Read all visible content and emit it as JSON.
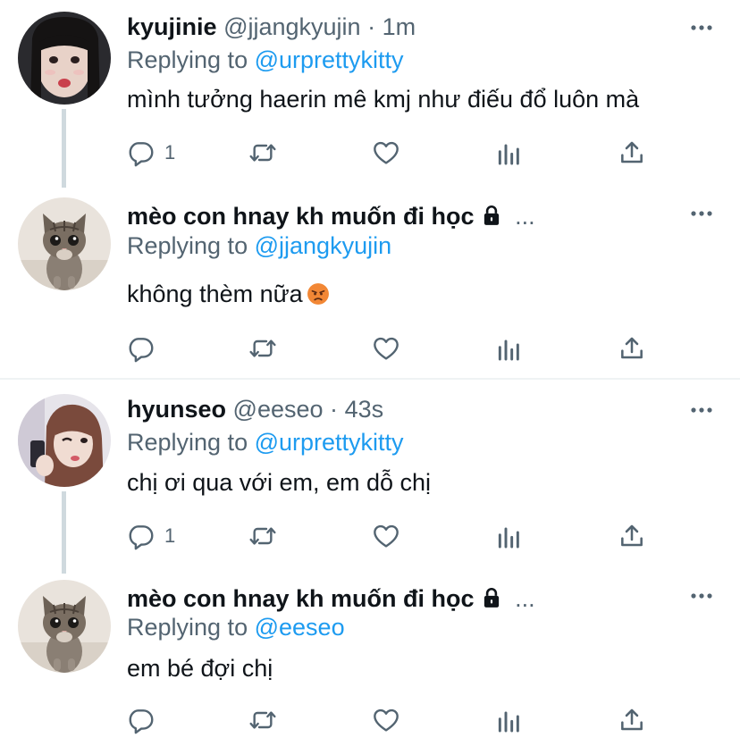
{
  "colors": {
    "link": "#1d9bf0",
    "muted": "#536471",
    "text": "#0f1419",
    "thread_line": "#cfd9de"
  },
  "tweets": [
    {
      "name": "kyujinie",
      "handle": "@jjangkyujin",
      "separator": "·",
      "time": "1m",
      "reply_prefix": "Replying to",
      "reply_to": "@urprettykitty",
      "text": "mình tưởng haerin mê kmj như điếu đổ luôn mà",
      "reply_count": "1",
      "avatar": "girl-photo-avatar"
    },
    {
      "name": "mèo con hnay kh muốn đi học",
      "protected_icon": "lock-icon",
      "truncation": "...",
      "reply_prefix": "Replying to",
      "reply_to": "@jjangkyujin",
      "text": "không thèm nữa",
      "emoji": "angry-face-emoji",
      "reply_count": "",
      "avatar": "kitten-photo-avatar"
    },
    {
      "name": "hyunseo",
      "handle": "@eeseo",
      "separator": "·",
      "time": "43s",
      "reply_prefix": "Replying to",
      "reply_to": "@urprettykitty",
      "text": "chị ơi qua với em, em dỗ chị",
      "reply_count": "1",
      "avatar": "girl-selfie-avatar"
    },
    {
      "name": "mèo con hnay kh muốn đi học",
      "protected_icon": "lock-icon",
      "truncation": "...",
      "reply_prefix": "Replying to",
      "reply_to": "@eeseo",
      "text": "em bé đợi chị",
      "reply_count": "",
      "avatar": "kitten-photo-avatar"
    }
  ],
  "action_icons": [
    "reply-icon",
    "retweet-icon",
    "like-icon",
    "analytics-icon",
    "share-icon"
  ]
}
